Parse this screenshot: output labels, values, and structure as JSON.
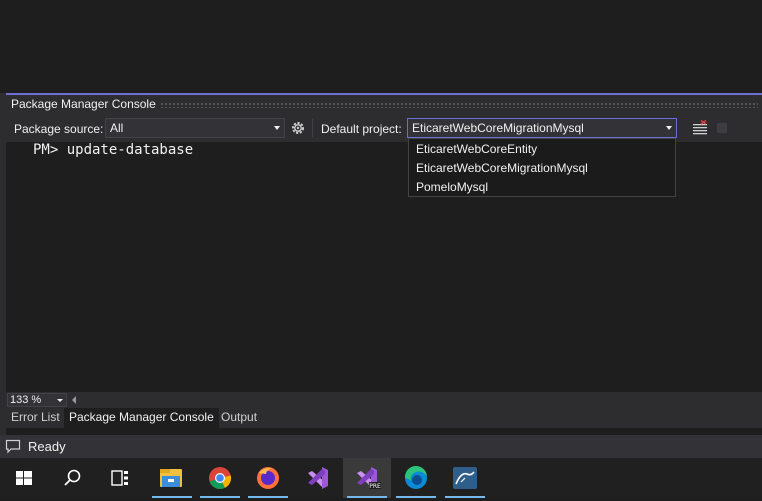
{
  "panel": {
    "title": "Package Manager Console"
  },
  "toolbar": {
    "package_source_label": "Package source:",
    "package_source_value": "All",
    "default_project_label": "Default project:",
    "default_project_value": "EticaretWebCoreMigrationMysql"
  },
  "console": {
    "line": "PM> update-database"
  },
  "dropdown": {
    "options": [
      "EticaretWebCoreEntity",
      "EticaretWebCoreMigrationMysql",
      "PomeloMysql"
    ]
  },
  "zoom": {
    "value": "133 %"
  },
  "tabs": [
    {
      "label": "Error List"
    },
    {
      "label": "Package Manager Console"
    },
    {
      "label": "Output"
    }
  ],
  "status": {
    "text": "Ready"
  },
  "taskbar": {
    "items": [
      "start-icon",
      "search-icon",
      "task-view-icon",
      "file-explorer-icon",
      "chrome-icon",
      "firefox-icon",
      "visual-studio-icon",
      "visual-studio-preview-icon",
      "edge-icon",
      "mysql-workbench-icon"
    ]
  },
  "colors": {
    "panel_accent": "#6d6dd6",
    "background": "#1e1e1e"
  }
}
